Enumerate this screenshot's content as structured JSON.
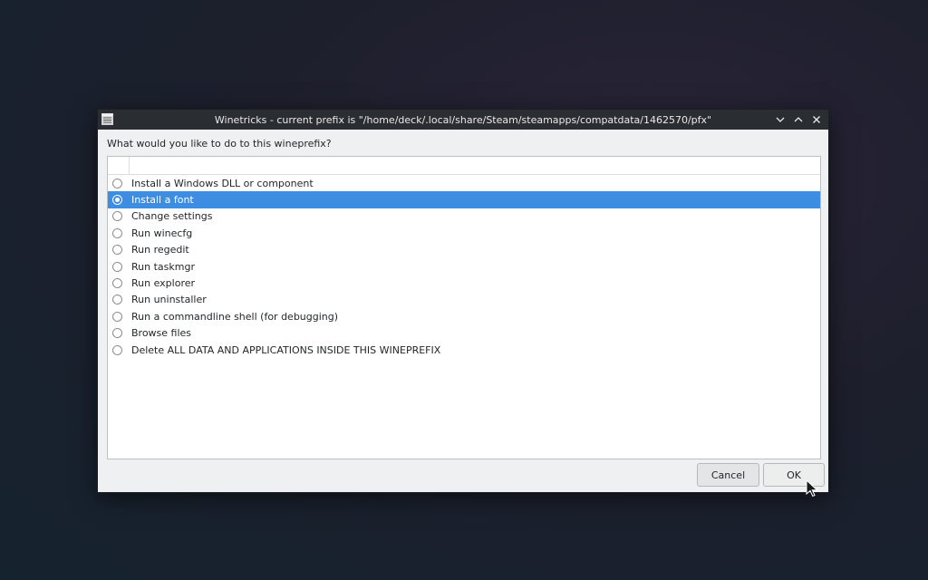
{
  "window": {
    "title": "Winetricks - current prefix is \"/home/deck/.local/share/Steam/steamapps/compatdata/1462570/pfx\"",
    "icon": "list-app-icon",
    "controls": [
      "minimize-icon",
      "maximize-icon",
      "close-icon"
    ]
  },
  "dialog": {
    "prompt": "What would you like to do to this wineprefix?",
    "options": [
      {
        "label": "Install a Windows DLL or component",
        "selected": false
      },
      {
        "label": "Install a font",
        "selected": true
      },
      {
        "label": "Change settings",
        "selected": false
      },
      {
        "label": "Run winecfg",
        "selected": false
      },
      {
        "label": "Run regedit",
        "selected": false
      },
      {
        "label": "Run taskmgr",
        "selected": false
      },
      {
        "label": "Run explorer",
        "selected": false
      },
      {
        "label": "Run uninstaller",
        "selected": false
      },
      {
        "label": "Run a commandline shell (for debugging)",
        "selected": false
      },
      {
        "label": "Browse files",
        "selected": false
      },
      {
        "label": "Delete ALL DATA AND APPLICATIONS INSIDE THIS WINEPREFIX",
        "selected": false
      }
    ],
    "cancel_label": "Cancel",
    "ok_label": "OK"
  },
  "colors": {
    "selection": "#3d8ee2",
    "titlebar": "#2a2e32",
    "window_bg": "#eff0f1"
  }
}
